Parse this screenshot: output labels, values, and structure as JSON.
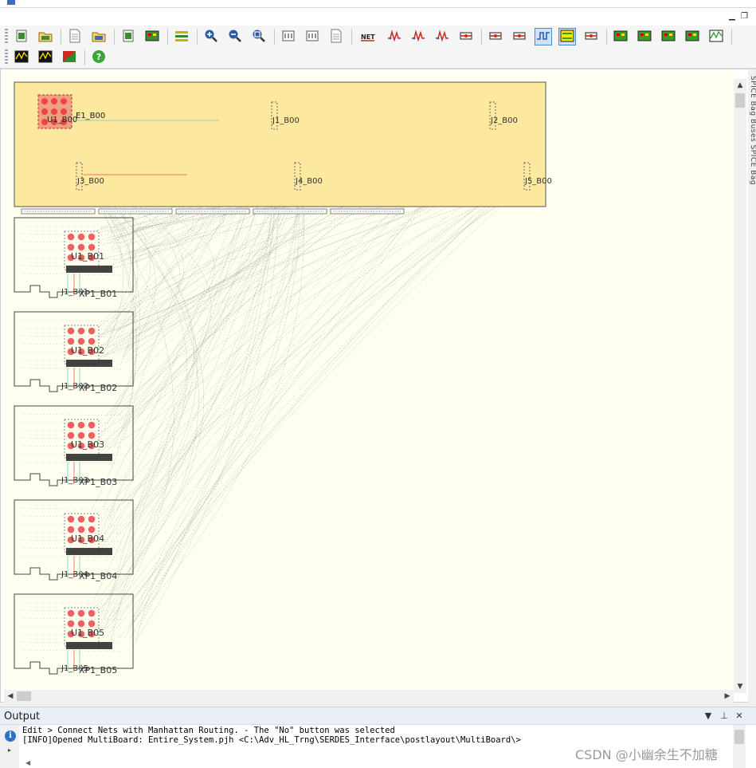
{
  "toolbar": {
    "row1": [
      {
        "name": "new-project-icon",
        "color": "#3c8d2f"
      },
      {
        "name": "open-project-icon",
        "color": "#3c8d2f"
      },
      {
        "name": "new-file-icon",
        "color": "#7a7a7a"
      },
      {
        "name": "open-file-icon",
        "color": "#2f6fbf"
      },
      {
        "name": "copy-board-icon",
        "color": "#3c8d2f"
      },
      {
        "name": "board-settings-icon",
        "color": "#3c8d2f"
      },
      {
        "name": "layer-stack-icon",
        "color": "#c8b400"
      },
      {
        "name": "zoom-in-icon",
        "color": "#2c5ca8"
      },
      {
        "name": "zoom-out-icon",
        "color": "#2c5ca8"
      },
      {
        "name": "zoom-fit-icon",
        "color": "#2c5ca8"
      },
      {
        "name": "matrix-icon",
        "color": "#555555"
      },
      {
        "name": "measure-icon",
        "color": "#555555"
      },
      {
        "name": "report-icon",
        "color": "#8a8a8a"
      },
      {
        "name": "netlist-icon",
        "color": "#cc2a1e"
      },
      {
        "name": "signal-integrity-icon",
        "color": "#cc2a1e"
      },
      {
        "name": "waveform-icon",
        "color": "#cc2a1e"
      },
      {
        "name": "crosstalk-icon",
        "color": "#cc2a1e"
      },
      {
        "name": "terminator-icon",
        "color": "#cc2a1e"
      },
      {
        "name": "connector-icon",
        "color": "#cc2a1e"
      },
      {
        "name": "coupled-lines-icon",
        "color": "#cc2a1e"
      },
      {
        "name": "manhattan-route-icon",
        "color": "#2c5ca8",
        "active": true
      },
      {
        "name": "connect-nets-icon",
        "color": "#2f9f2f",
        "active": true
      },
      {
        "name": "route-wizard-icon",
        "color": "#cc2a1e"
      },
      {
        "name": "board-red-icon",
        "color": "#3a9a2a"
      },
      {
        "name": "board-green-icon",
        "color": "#3a9a2a"
      },
      {
        "name": "board-yellow-icon",
        "color": "#3a9a2a"
      },
      {
        "name": "board-multi-icon",
        "color": "#3a9a2a"
      },
      {
        "name": "scope-icon",
        "color": "#1e1e1e"
      }
    ],
    "row2": [
      {
        "name": "eye-diagram-icon",
        "color": "#2e7d2e"
      },
      {
        "name": "spectrum-icon",
        "color": "#2e7d2e"
      },
      {
        "name": "color-map-icon",
        "color": "#cc2a1e"
      },
      {
        "name": "help-icon",
        "color": "#3aa63a"
      }
    ]
  },
  "side_tab": {
    "label": "SPICE Bag Buses SPICE Bag"
  },
  "boards": [
    {
      "ref": "U1_B01",
      "conn": "J1_B01",
      "conn2": "XP1_B01"
    },
    {
      "ref": "U1_B02",
      "conn": "J1_B02",
      "conn2": "XP1_B02"
    },
    {
      "ref": "U1_B03",
      "conn": "J1_B03",
      "conn2": "XP1_B03"
    },
    {
      "ref": "U1_B04",
      "conn": "J1_B04",
      "conn2": "XP1_B04"
    },
    {
      "ref": "U1_B05",
      "conn": "J1_B05",
      "conn2": "XP1_B05"
    }
  ],
  "top_panel": {
    "labels": [
      "E1_B00",
      "U1_B00",
      "J1_B00",
      "J2_B00",
      "J3_B00",
      "J4_B00",
      "J5_B00"
    ]
  },
  "output": {
    "title": "Output",
    "line1": "Edit > Connect Nets with Manhattan Routing. - The \"No\" button was selected",
    "line2": "[INFO]Opened MultiBoard: Entire_System.pjh <C:\\Adv_HL_Trng\\SERDES_Interface\\postlayout\\MultiBoard\\>"
  },
  "watermark": "CSDN @小幽余生不加糖"
}
